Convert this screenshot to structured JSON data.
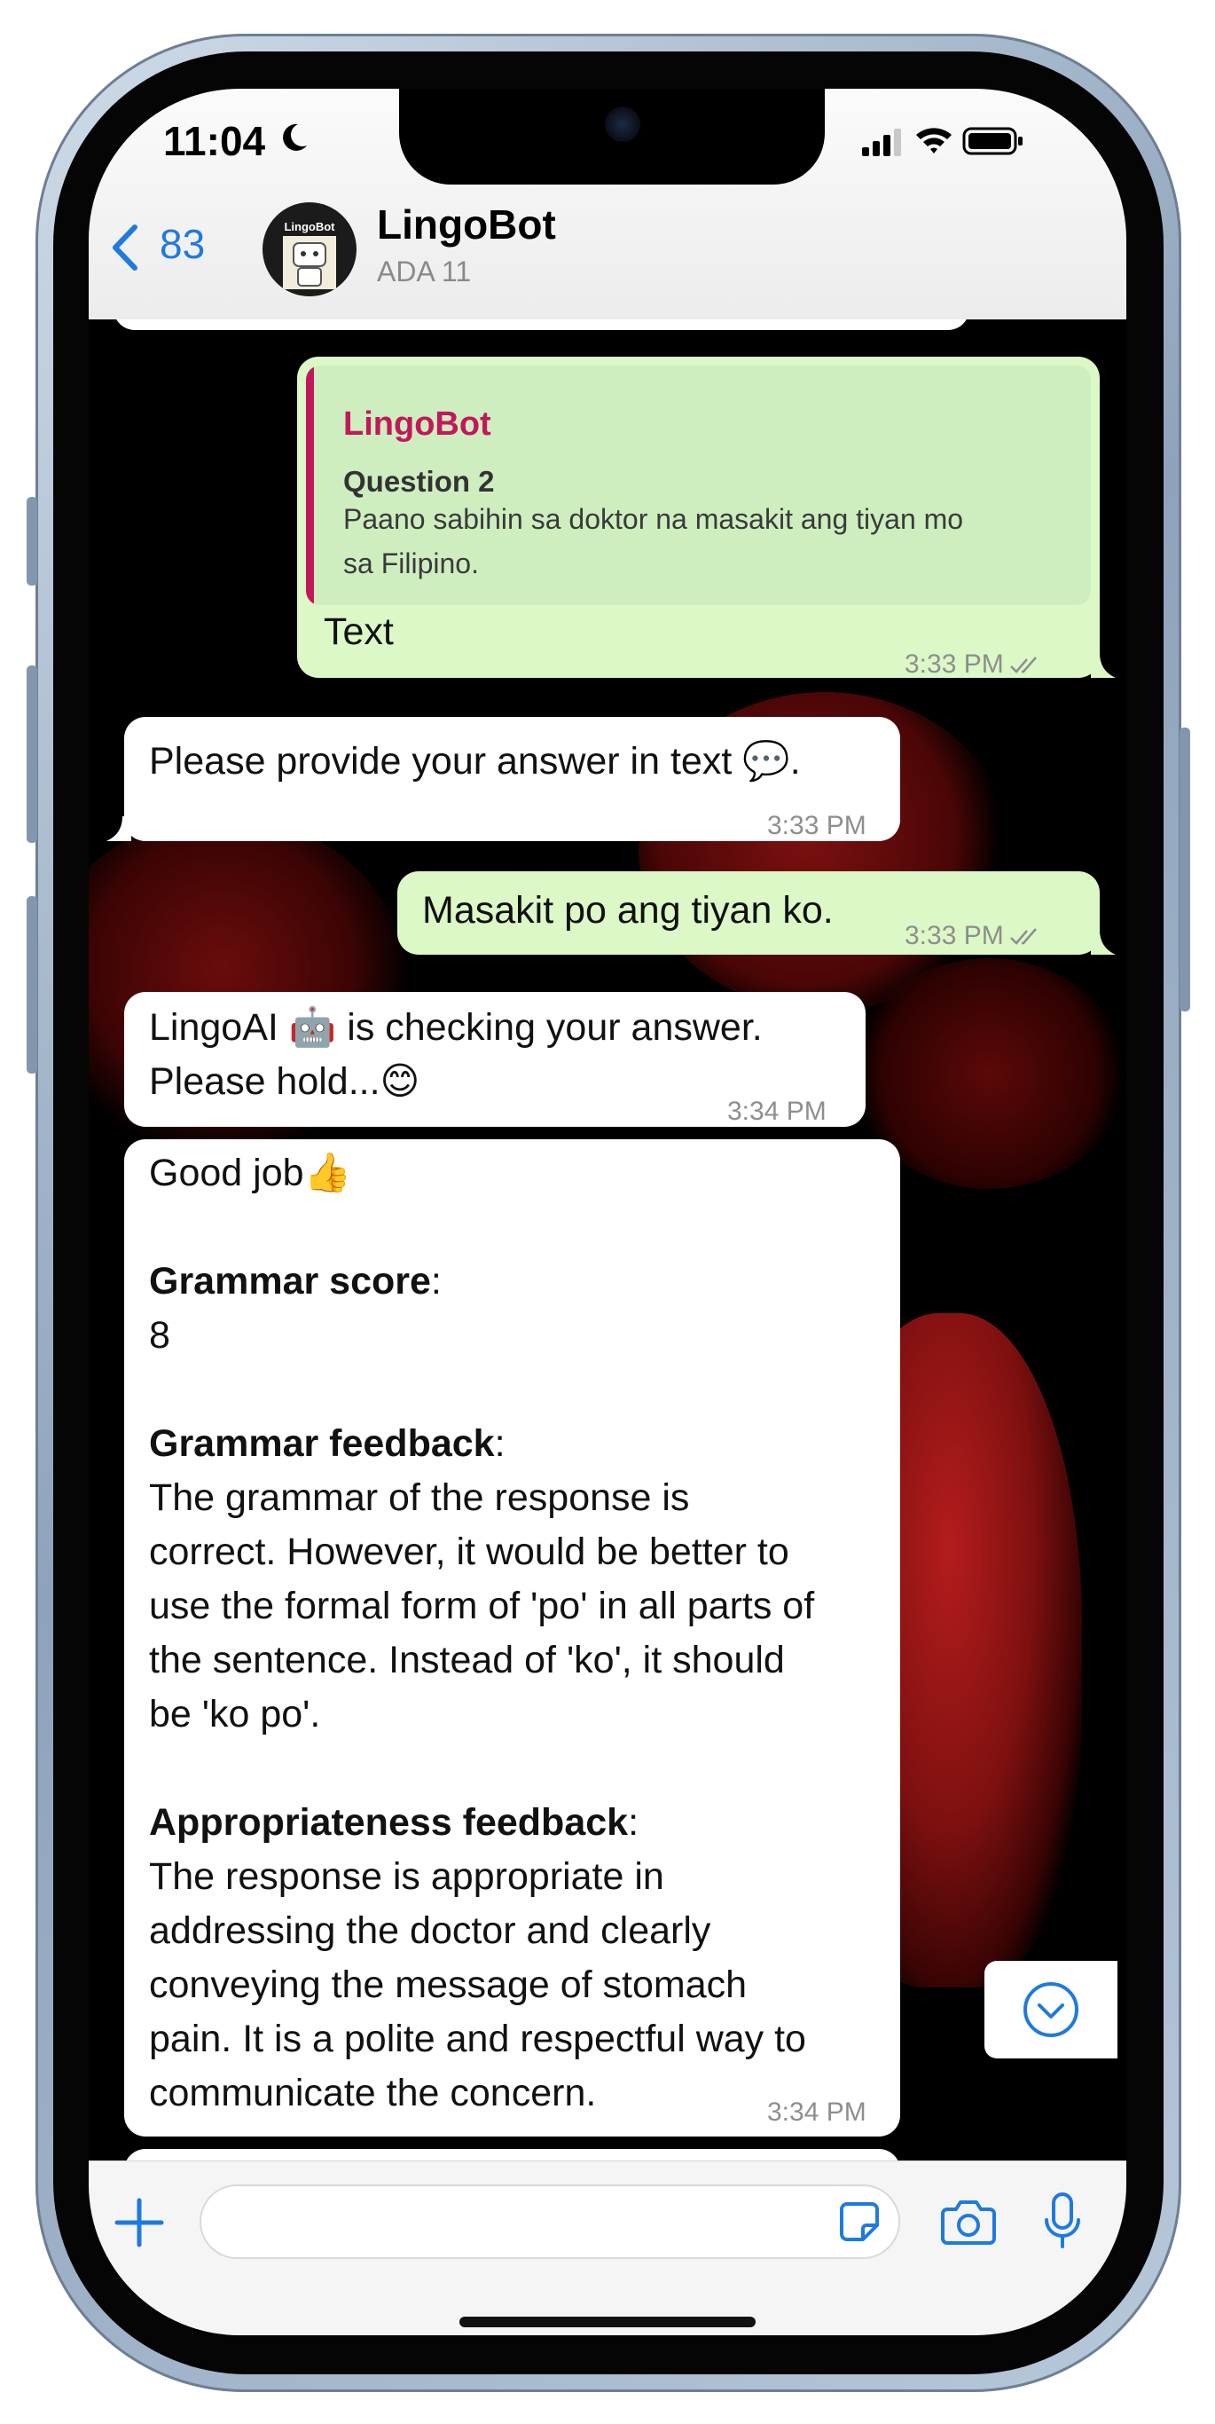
{
  "status_bar": {
    "time": "11:04"
  },
  "header": {
    "back_count": "83",
    "avatar_text": "LingoBot",
    "contact_name": "LingoBot",
    "contact_subtitle": "ADA 11"
  },
  "messages": [
    {
      "direction": "out",
      "quoted": {
        "sender": "LingoBot",
        "title": "Question 2",
        "body_lines": [
          "Paano sabihin sa doktor na masakit ang tiyan mo",
          "sa Filipino."
        ]
      },
      "text": "Text",
      "time": "3:33 PM"
    },
    {
      "direction": "in",
      "text": "Please provide your answer in text 💬.",
      "time": "3:33 PM"
    },
    {
      "direction": "out",
      "text": "Masakit po ang tiyan ko.",
      "time": "3:33 PM"
    },
    {
      "direction": "in",
      "lines": [
        "LingoAI 🤖 is checking your answer.",
        "Please hold...😊"
      ],
      "time": "3:34 PM"
    },
    {
      "direction": "in",
      "intro": "Good job👍",
      "grammar_score_label": "Grammar score",
      "grammar_score_value": "8",
      "grammar_feedback_label": "Grammar feedback",
      "grammar_feedback_lines": [
        "The grammar of the response is",
        "correct. However, it would be better to",
        "use the formal form of 'po' in all parts of",
        "the sentence. Instead of 'ko', it should",
        "be 'ko po'."
      ],
      "appropriateness_label": "Appropriateness feedback",
      "appropriateness_lines": [
        "The response is appropriate in",
        "addressing the doctor and clearly",
        "conveying the message of stomach",
        "pain. It is a polite and respectful way to",
        "communicate the concern."
      ],
      "time": "3:34 PM"
    }
  ],
  "input": {
    "value": "",
    "placeholder": ""
  },
  "colors": {
    "accent_blue": "#1f7ae0",
    "outgoing_bubble": "#dcf8c6",
    "incoming_bubble": "#ffffff",
    "quote_sender": "#c2185b"
  }
}
